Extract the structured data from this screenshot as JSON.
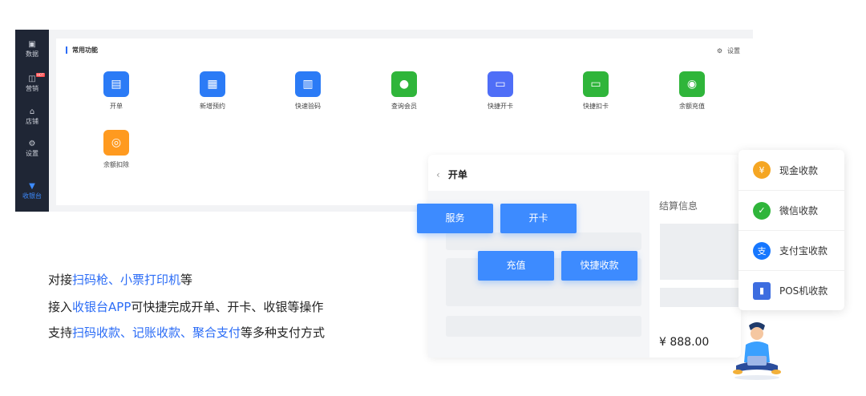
{
  "sidebar": {
    "items": [
      {
        "label": "数据",
        "icon": "chart-icon"
      },
      {
        "label": "营销",
        "icon": "gift-icon",
        "badge": "HOT"
      },
      {
        "label": "店铺",
        "icon": "store-icon"
      },
      {
        "label": "设置",
        "icon": "gear-icon"
      },
      {
        "label": "收银台",
        "icon": "cashier-icon",
        "active": true
      }
    ]
  },
  "main": {
    "section_title": "常用功能",
    "settings_label": "设置",
    "functions": [
      {
        "label": "开单",
        "icon": "order-icon",
        "color": "#2b7bf6"
      },
      {
        "label": "新增预约",
        "icon": "appointment-icon",
        "color": "#2b7bf6"
      },
      {
        "label": "快速验码",
        "icon": "barcode-icon",
        "color": "#2b7bf6"
      },
      {
        "label": "查询会员",
        "icon": "member-search-icon",
        "color": "#2fb53a"
      },
      {
        "label": "快捷开卡",
        "icon": "card-add-icon",
        "color": "#4f6ef7"
      },
      {
        "label": "快捷扣卡",
        "icon": "card-deduct-icon",
        "color": "#2fb53a"
      },
      {
        "label": "余额充值",
        "icon": "recharge-icon",
        "color": "#2fb53a"
      },
      {
        "label": "余额扣除",
        "icon": "deduct-icon",
        "color": "#ff9a1f"
      }
    ]
  },
  "description": {
    "line1": {
      "a": "对接",
      "b": "扫码枪、小票打印机",
      "c": "等"
    },
    "line2": {
      "a": "接入",
      "b": "收银台APP",
      "c": "可快捷完成开单、开卡、收银等操作"
    },
    "line3": {
      "a": "支持",
      "b": "扫码收款、记账收款、聚合支付",
      "c": "等多种支付方式"
    }
  },
  "order_panel": {
    "title": "开单",
    "settle_label": "结算信息",
    "price": "¥ 888.00",
    "buttons": [
      "服务",
      "开卡",
      "充值",
      "快捷收款"
    ]
  },
  "payment_methods": [
    {
      "label": "现金收款",
      "icon": "cash-icon",
      "color": "#f5a623"
    },
    {
      "label": "微信收款",
      "icon": "wechat-icon",
      "color": "#2fb53a"
    },
    {
      "label": "支付宝收款",
      "icon": "alipay-icon",
      "color": "#1677ff"
    },
    {
      "label": "POS机收款",
      "icon": "pos-icon",
      "color": "#3d6de0"
    }
  ],
  "colors": {
    "accent": "#3d8bff",
    "sidebar": "#1f2635",
    "highlight": "#2b6cf6"
  }
}
